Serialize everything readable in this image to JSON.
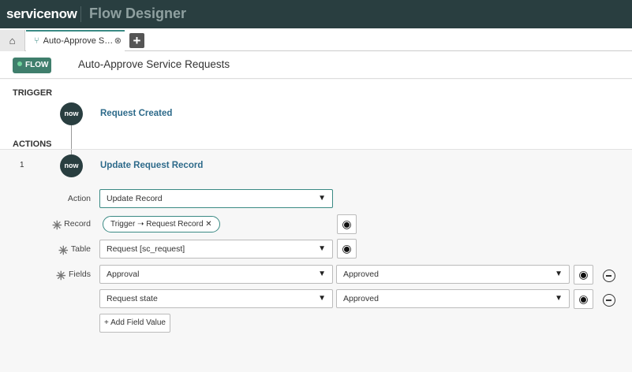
{
  "header": {
    "logo": "servicenow",
    "app_title": "Flow Designer"
  },
  "tabs": {
    "home_icon": "home-icon",
    "active": {
      "label": "Auto-Approve S…",
      "icon": "flow-icon",
      "close": "⊗"
    },
    "add": "+"
  },
  "flow": {
    "badge": "FLOW",
    "title": "Auto-Approve Service Requests"
  },
  "trigger": {
    "section": "TRIGGER",
    "icon_text": "now",
    "name": "Request Created"
  },
  "actions": {
    "section": "ACTIONS",
    "number": "1",
    "icon_text": "now",
    "name": "Update Request Record",
    "action_label": "Action",
    "action_value": "Update Record",
    "record_label": "Record",
    "record_pill": "Trigger ➝ Request Record",
    "record_pill_close": "✕",
    "table_label": "Table",
    "table_value": "Request [sc_request]",
    "fields_label": "Fields",
    "fields": [
      {
        "field": "Approval",
        "value": "Approved"
      },
      {
        "field": "Request state",
        "value": "Approved"
      }
    ],
    "add_field": "+ Add Field Value",
    "required_mark": "✳",
    "dropdown_arrow": "▼",
    "data_pill_icon": "data-pill-picker-icon"
  },
  "colors": {
    "header": "#293e40",
    "accent": "#3a8a84",
    "badge": "#3f7e6c"
  }
}
